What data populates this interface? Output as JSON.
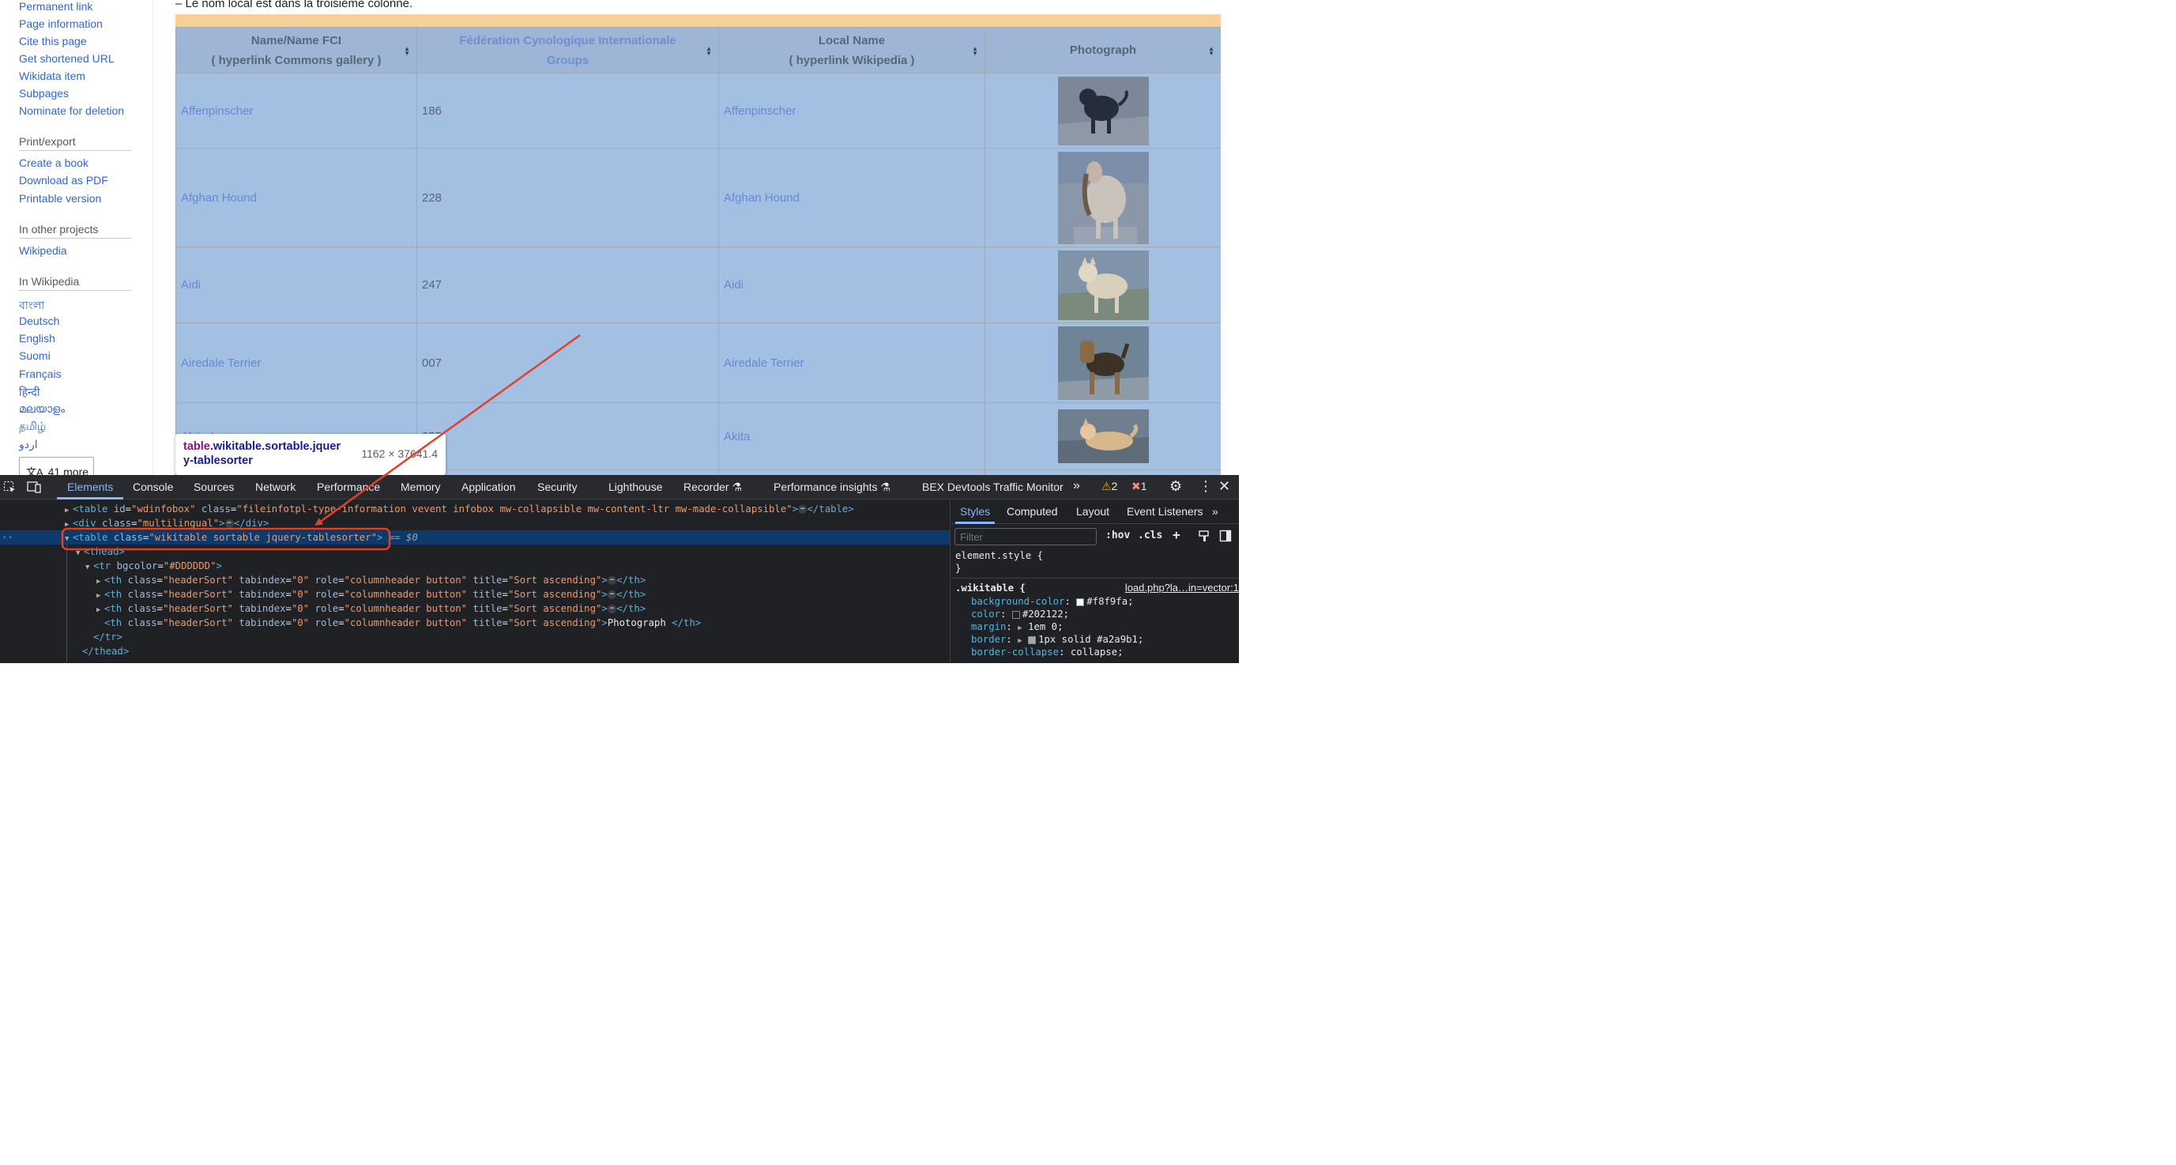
{
  "sidebar": {
    "tools_links": [
      "Permanent link",
      "Page information",
      "Cite this page",
      "Get shortened URL",
      "Wikidata item",
      "Subpages",
      "Nominate for deletion"
    ],
    "print_heading": "Print/export",
    "print_links": [
      "Create a book",
      "Download as PDF",
      "Printable version"
    ],
    "projects_heading": "In other projects",
    "projects_links": [
      "Wikipedia"
    ],
    "wikipedia_heading": "In Wikipedia",
    "language_links": [
      "বাংলা",
      "Deutsch",
      "English",
      "Suomi",
      "Français",
      "हिन्दी",
      "മലയാളം",
      "தமிழ்",
      "اردو"
    ],
    "more_languages": "41 more",
    "translate_icon": "文A"
  },
  "page": {
    "intro_text": "– Le nom local est dans la troisième colonne."
  },
  "table": {
    "headers": [
      {
        "line1": "Name/Name FCI",
        "line2": "( hyperlink Commons gallery )"
      },
      {
        "line1": "Fédération Cynologique Internationale",
        "line2": "Groups"
      },
      {
        "line1": "Local Name",
        "line2": "( hyperlink Wikipedia )"
      },
      {
        "line1": "Photograph",
        "line2": ""
      }
    ],
    "rows": [
      {
        "name": "Affenpinscher",
        "fci": "186",
        "local": "Affenpinscher"
      },
      {
        "name": "Afghan Hound",
        "fci": "228",
        "local": "Afghan Hound"
      },
      {
        "name": "Aidi",
        "fci": "247",
        "local": "Aidi"
      },
      {
        "name": "Airedale Terrier",
        "fci": "007",
        "local": "Airedale Terrier"
      },
      {
        "name": "Akita Inu",
        "fci": "255",
        "local": "Akita"
      }
    ]
  },
  "tooltip": {
    "tag": "table",
    "classes_line1": ".wikitable.sortable.jquer",
    "classes_line2": "y-tablesorter",
    "dimensions": "1162 × 37641.4"
  },
  "devtools": {
    "tabs": [
      "Elements",
      "Console",
      "Sources",
      "Network",
      "Performance",
      "Memory",
      "Application",
      "Security",
      "Lighthouse",
      "Recorder",
      "Performance insights",
      "BEX Devtools Traffic Monitor"
    ],
    "overflow": "»",
    "warning_count": "2",
    "error_count": "1",
    "styles_tabs": [
      "Styles",
      "Computed",
      "Layout",
      "Event Listeners"
    ],
    "filter_placeholder": "Filter",
    "hov": ":hov",
    "cls": ".cls",
    "selected_marker": "== $0",
    "dom": {
      "line1": {
        "attr1": "id",
        "val1": "\"wdinfobox\"",
        "attr2": "class",
        "val2": "\"fileinfotpl-type-information vevent infobox mw-collapsible mw-content-ltr mw-made-collapsible\""
      },
      "line2": {
        "attr": "class",
        "val": "\"multilingual\""
      },
      "line3": {
        "attr": "class",
        "val": "\"wikitable sortable jquery-tablesorter\""
      },
      "line5": {
        "attr": "bgcolor",
        "val": "\"#DDDDDD\""
      },
      "th": {
        "class_val": "\"headerSort\"",
        "tabindex_val": "\"0\"",
        "role_val": "\"columnheader button\"",
        "title_val": "\"Sort ascending\""
      },
      "th_last_text": "Photograph "
    },
    "css": {
      "element_style": "element.style {",
      "close": "}",
      "selector": ".wikitable {",
      "source": "load.php?la…in=vector:1",
      "props": [
        {
          "name": "background-color",
          "value": "#f8f9fa;",
          "swatch": "#f8f9fa"
        },
        {
          "name": "color",
          "value": "#202122;",
          "swatch": "#202122"
        },
        {
          "name": "margin",
          "value": "1em 0;",
          "swatch": ""
        },
        {
          "name": "border",
          "value": "1px solid #a2a9b1;",
          "swatch": "#a2a9b1"
        },
        {
          "name": "border-collapse",
          "value": "collapse;",
          "swatch": ""
        }
      ]
    }
  },
  "colors": {
    "annotation": "#e0402a",
    "highlight_content": "#a3bfe2",
    "highlight_margin": "#f6cf99",
    "devtools_bg": "#202124"
  }
}
